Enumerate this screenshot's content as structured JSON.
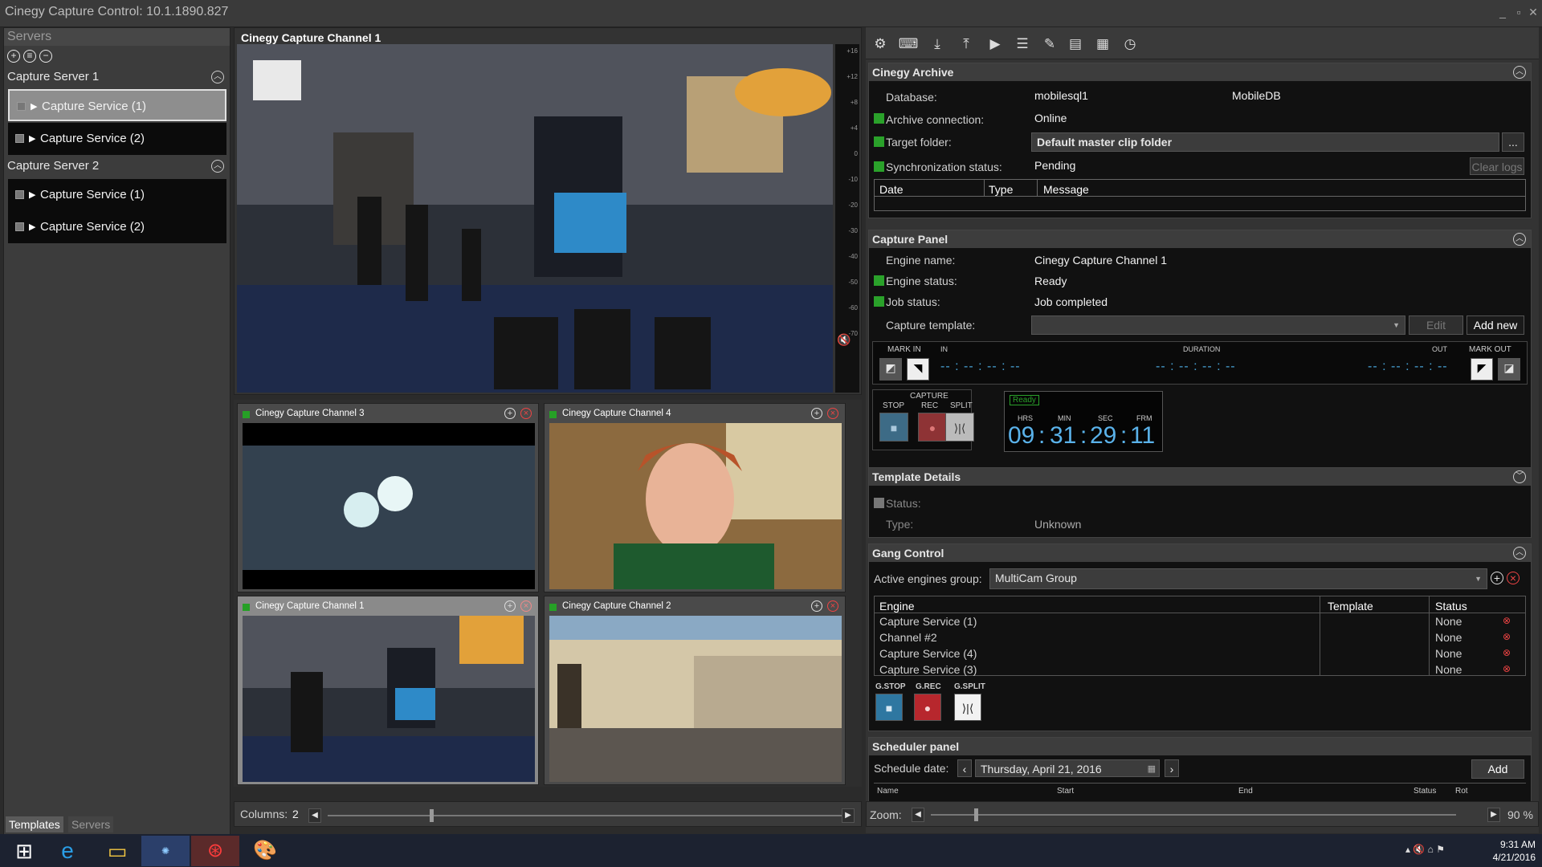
{
  "window": {
    "title": "Cinegy Capture Control: 10.1.1890.827"
  },
  "left": {
    "header": "Servers",
    "tabs": [
      "Templates",
      "Servers"
    ],
    "servers": [
      {
        "name": "Capture Server 1",
        "services": [
          "Capture Service (1)",
          "Capture Service (2)"
        ]
      },
      {
        "name": "Capture Server 2",
        "services": [
          "Capture Service (1)",
          "Capture Service (2)"
        ]
      }
    ]
  },
  "main": {
    "title": "Cinegy Capture Channel 1",
    "meter_scale": [
      "+16",
      "+12",
      "+8",
      "+4",
      "0",
      "-10",
      "-20",
      "-30",
      "-40",
      "-50",
      "-60",
      "-70"
    ],
    "channels": [
      "Cinegy Capture Channel 3",
      "Cinegy Capture Channel 4",
      "Cinegy Capture Channel 1",
      "Cinegy Capture Channel 2"
    ],
    "columns_label": "Columns:",
    "columns_value": "2"
  },
  "archive": {
    "title": "Cinegy Archive",
    "database_label": "Database:",
    "database_server": "mobilesql1",
    "database_name": "MobileDB",
    "connection_label": "Archive connection:",
    "connection_value": "Online",
    "target_label": "Target folder:",
    "target_value": "Default master clip folder",
    "target_btn": "...",
    "sync_label": "Synchronization status:",
    "sync_value": "Pending",
    "clear_logs": "Clear logs",
    "columns": [
      "Date",
      "Type",
      "Message"
    ]
  },
  "capture_panel": {
    "title": "Capture Panel",
    "engine_name_label": "Engine name:",
    "engine_name": "Cinegy Capture Channel 1",
    "engine_status_label": "Engine status:",
    "engine_status": "Ready",
    "job_status_label": "Job status:",
    "job_status": "Job completed",
    "template_label": "Capture template:",
    "edit": "Edit",
    "add_new": "Add new",
    "mark_in": "MARK IN",
    "mark_out": "MARK OUT",
    "in_label": "IN",
    "duration_label": "DURATION",
    "out_label": "OUT",
    "in_tc": "-- : -- : -- : --",
    "duration_tc": "-- : -- : -- : --",
    "out_tc": "-- : -- : -- : --",
    "capture_label": "CAPTURE",
    "stop": "STOP",
    "rec": "REC",
    "split": "SPLIT",
    "ready": "Ready",
    "hrs": "HRS",
    "min": "MIN",
    "sec": "SEC",
    "frm": "FRM",
    "tc_h": "09",
    "tc_m": "31",
    "tc_s": "29",
    "tc_f": "11"
  },
  "template_details": {
    "title": "Template Details",
    "status_label": "Status:",
    "type_label": "Type:",
    "type_value": "Unknown"
  },
  "gang": {
    "title": "Gang Control",
    "group_label": "Active engines group:",
    "group_value": "MultiCam Group",
    "columns": [
      "Engine",
      "Template",
      "Status"
    ],
    "rows": [
      [
        "Capture Service (1)",
        "",
        "None"
      ],
      [
        "Channel #2",
        "",
        "None"
      ],
      [
        "Capture Service (4)",
        "",
        "None"
      ],
      [
        "Capture Service (3)",
        "",
        "None"
      ]
    ],
    "g_stop": "G.STOP",
    "g_rec": "G.REC",
    "g_split": "G.SPLIT"
  },
  "scheduler": {
    "title": "Scheduler panel",
    "date_label": "Schedule date:",
    "date_value": "Thursday, April 21, 2016",
    "add": "Add",
    "columns": [
      "Name",
      "Start",
      "End",
      "Status",
      "Rot"
    ]
  },
  "zoom": {
    "label": "Zoom:",
    "value": "90 %"
  },
  "taskbar": {
    "time": "9:31 AM",
    "date": "4/21/2016"
  },
  "colors": {
    "accent": "#48a3d6",
    "ok": "#2aa12a",
    "rec": "#c0393b"
  }
}
